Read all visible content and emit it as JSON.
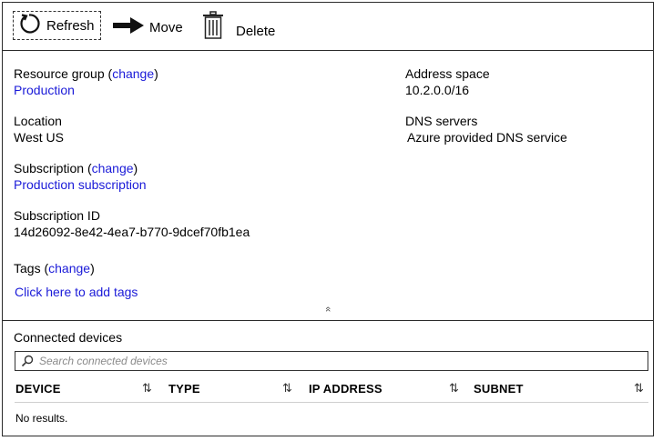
{
  "toolbar": {
    "refresh_label": "Refresh",
    "move_label": "Move",
    "delete_label": "Delete"
  },
  "properties": {
    "resource_group": {
      "label": "Resource group",
      "change": "change",
      "value": "Production"
    },
    "location": {
      "label": "Location",
      "value": "West US"
    },
    "subscription": {
      "label": "Subscription",
      "change": "change",
      "value": "Production subscription"
    },
    "subscription_id": {
      "label": "Subscription ID",
      "value": "14d26092-8e42-4ea7-b770-9dcef70fb1ea"
    },
    "tags": {
      "label": "Tags",
      "change": "change",
      "add_link": "Click here to add tags"
    },
    "address_space": {
      "label": "Address space",
      "value": "10.2.0.0/16"
    },
    "dns_servers": {
      "label": "DNS servers",
      "value": "Azure provided DNS service"
    },
    "collapse_glyph": "«"
  },
  "devices": {
    "title": "Connected devices",
    "search_placeholder": "Search connected devices",
    "columns": [
      "DEVICE",
      "TYPE",
      "IP ADDRESS",
      "SUBNET"
    ],
    "sort_glyph": "⇅",
    "empty_text": "No results."
  },
  "colors": {
    "link": "#1a1ad8",
    "border": "#2b2b2b"
  }
}
